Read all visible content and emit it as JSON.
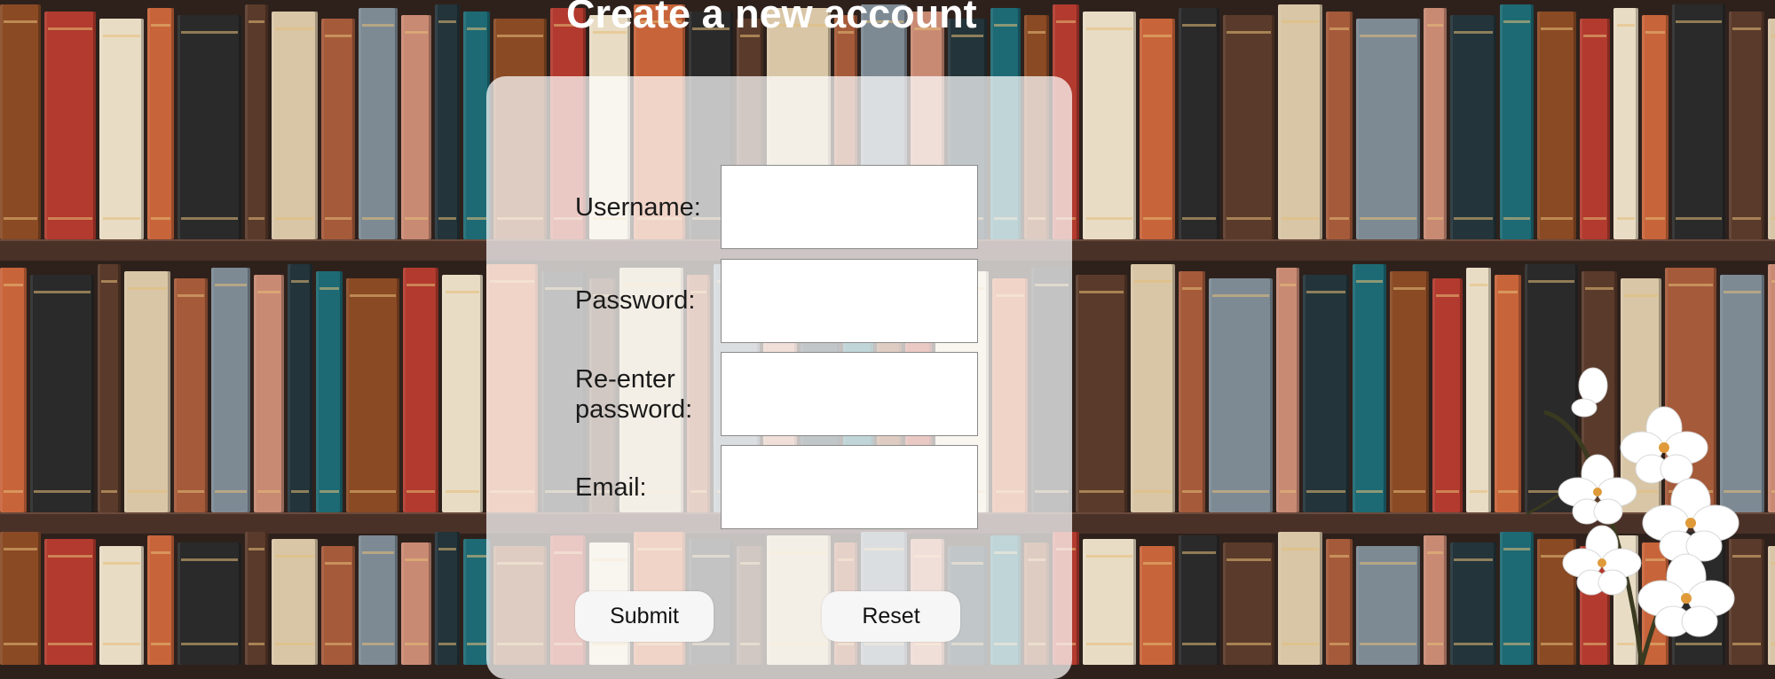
{
  "page": {
    "title": "Create a new account"
  },
  "form": {
    "fields": [
      {
        "label": "Username:",
        "type": "text",
        "value": ""
      },
      {
        "label": "Password:",
        "type": "password",
        "value": ""
      },
      {
        "label": "Re-enter password:",
        "type": "password",
        "value": ""
      },
      {
        "label": "Email:",
        "type": "email",
        "value": ""
      }
    ],
    "submit_label": "Submit",
    "reset_label": "Reset"
  },
  "colors": {
    "title": "#ffffff",
    "panel": "#ffffffb8",
    "input_border": "#8a8a8a"
  },
  "decorations": {
    "background": "bookshelf-image",
    "corner": "white-orchid-image"
  }
}
